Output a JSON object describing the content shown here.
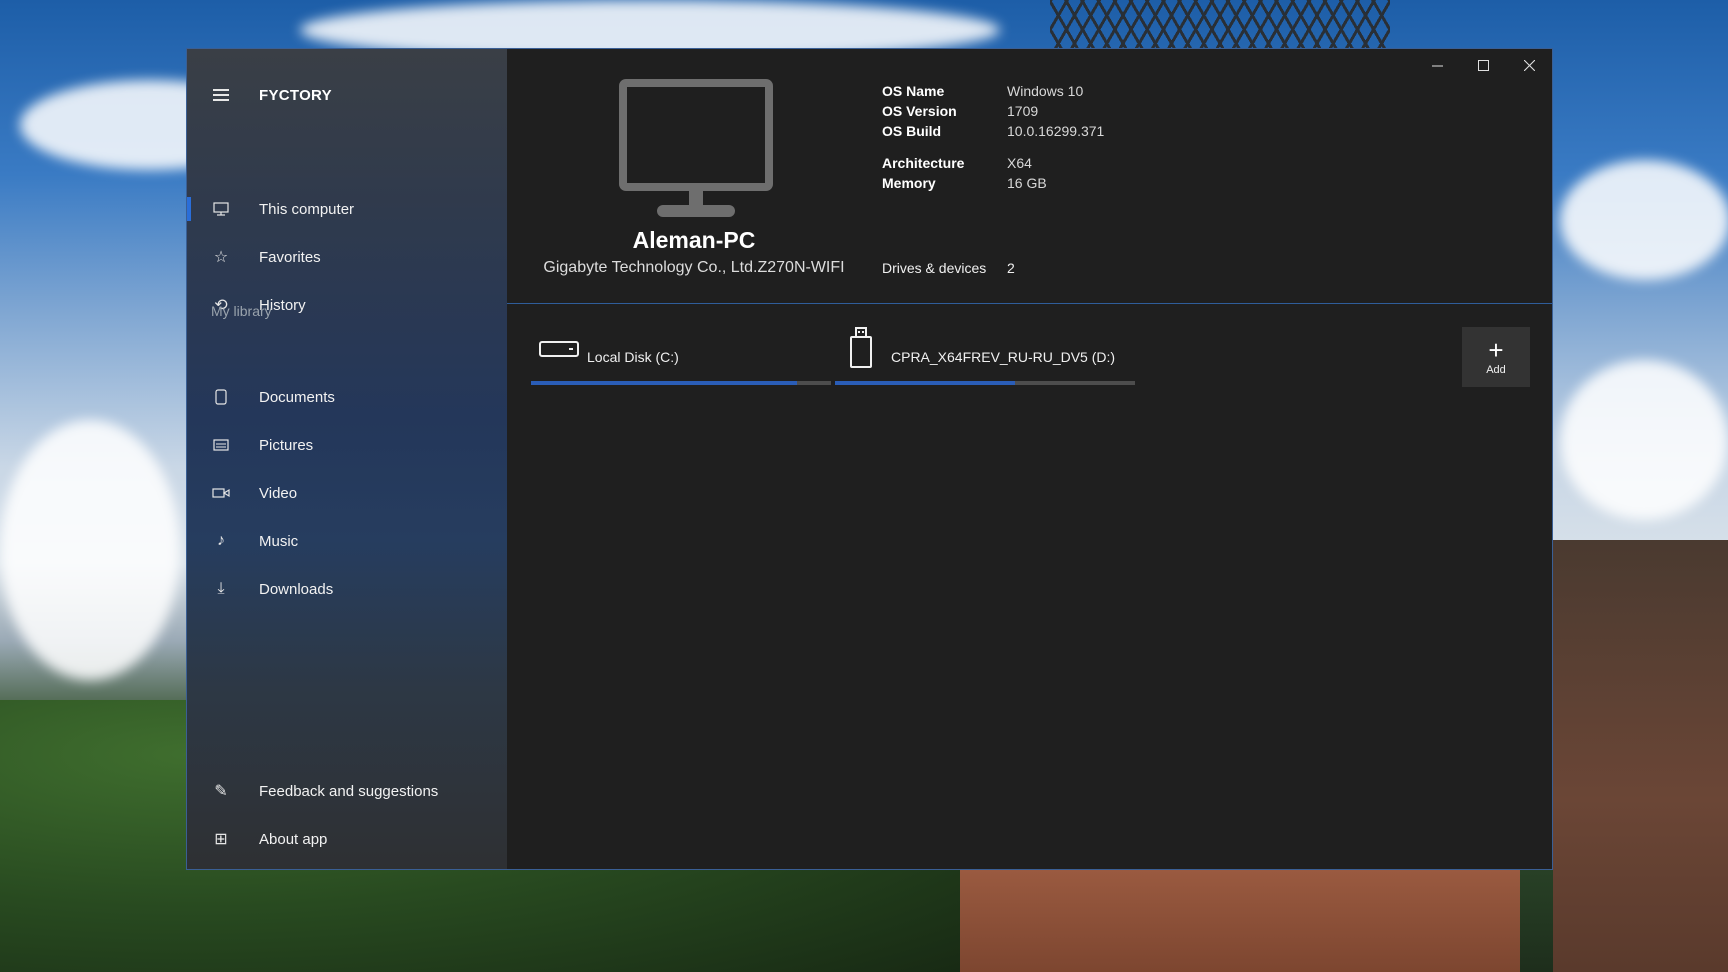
{
  "app": {
    "title": "FYCTORY"
  },
  "window_controls": {
    "minimize": "—",
    "maximize": "☐",
    "close": "✕"
  },
  "sidebar": {
    "menu_icon": "hamburger-icon",
    "items": [
      {
        "label": "This computer",
        "icon": "monitor-icon",
        "glyph": "🖵",
        "selected": true
      },
      {
        "label": "Favorites",
        "icon": "star-icon",
        "glyph": "☆"
      },
      {
        "label": "History",
        "icon": "history-icon",
        "glyph": "⟲"
      }
    ],
    "library_label": "My library",
    "library": [
      {
        "label": "Documents",
        "icon": "document-icon",
        "glyph": "▯"
      },
      {
        "label": "Pictures",
        "icon": "pictures-icon",
        "glyph": "▤"
      },
      {
        "label": "Video",
        "icon": "video-icon",
        "glyph": "▭"
      },
      {
        "label": "Music",
        "icon": "music-icon",
        "glyph": "♪"
      },
      {
        "label": "Downloads",
        "icon": "download-icon",
        "glyph": "⤓"
      }
    ],
    "footer": [
      {
        "label": "Feedback and suggestions",
        "icon": "feedback-icon",
        "glyph": "✎"
      },
      {
        "label": "About app",
        "icon": "about-icon",
        "glyph": "⊞"
      }
    ]
  },
  "computer": {
    "name": "Aleman-PC",
    "model": "Gigabyte Technology Co., Ltd.Z270N-WIFI"
  },
  "system_info": [
    {
      "key": "OS Name",
      "value": "Windows 10"
    },
    {
      "key": "OS Version",
      "value": "1709"
    },
    {
      "key": "OS Build",
      "value": "10.0.16299.371"
    },
    {
      "key": "Architecture",
      "value": "X64"
    },
    {
      "key": "Memory",
      "value": "16 GB"
    }
  ],
  "drives_summary": {
    "label": "Drives & devices",
    "count": "2"
  },
  "drives": [
    {
      "label": "Local Disk (C:)",
      "icon": "hard-drive-icon",
      "used_fraction": 0.885
    },
    {
      "label": "CPRA_X64FREV_RU-RU_DV5 (D:)",
      "icon": "usb-drive-icon",
      "used_fraction": 0.6
    }
  ],
  "add_button": {
    "label": "Add",
    "glyph": "+"
  },
  "colors": {
    "accent": "#2a6ed9",
    "usage_bar": "#2a5db7",
    "window_bg": "#1f1f1f"
  }
}
